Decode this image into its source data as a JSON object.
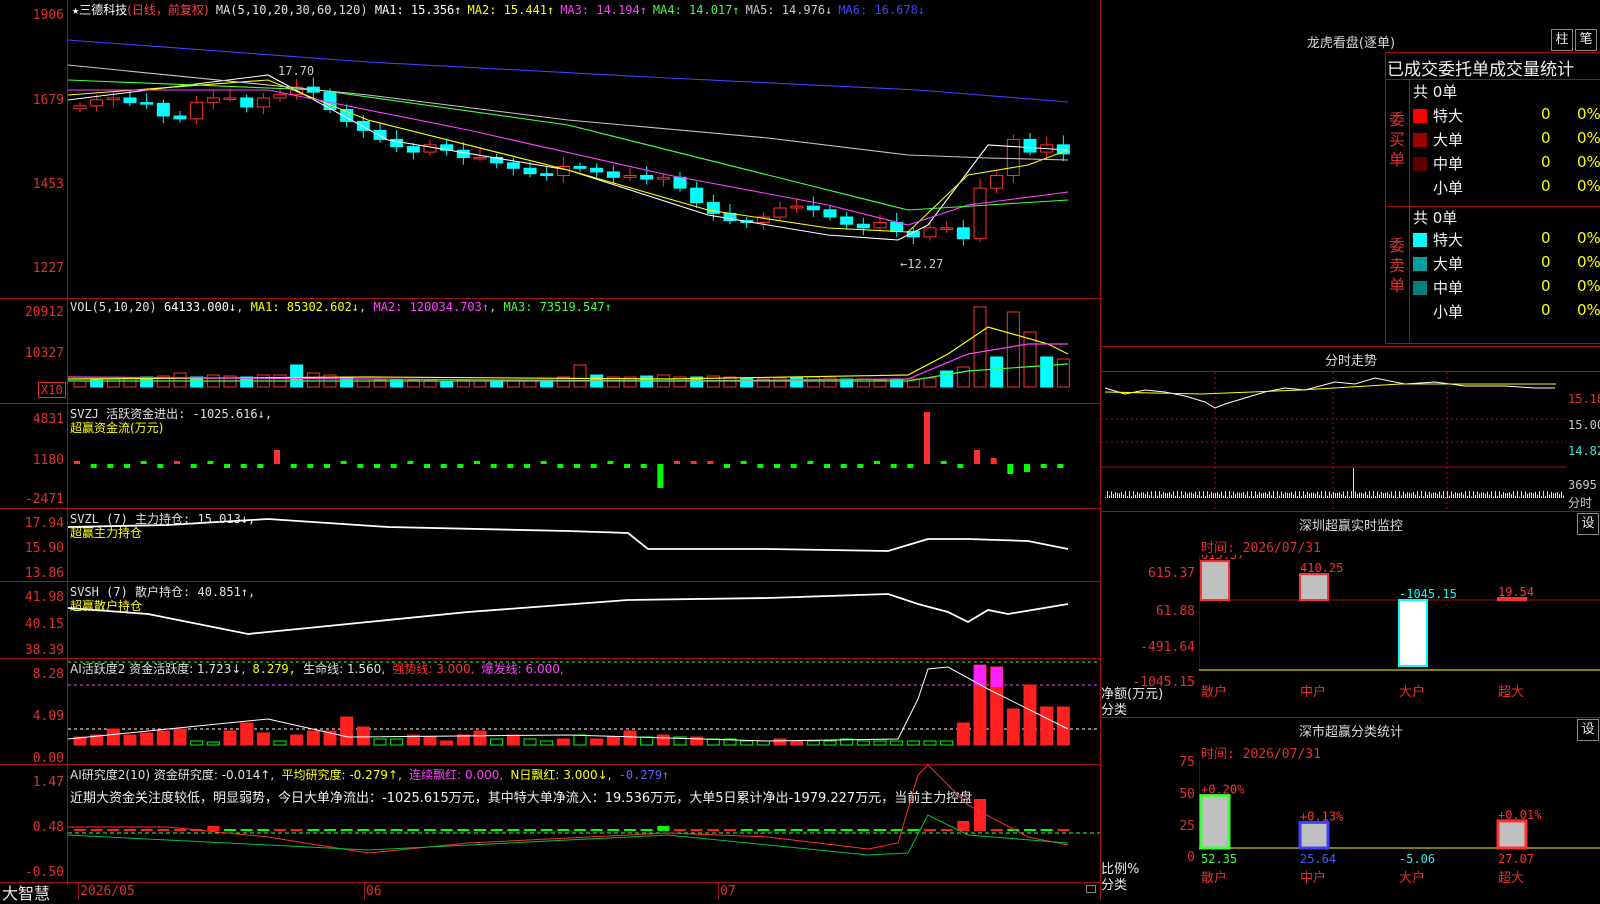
{
  "app": {
    "name": "大智慧"
  },
  "kline": {
    "title": "三德科技",
    "period": "(日线，前复权)",
    "ma_label": "MA(5,10,20,30,60,120)",
    "ma": [
      {
        "label": "MA1: 15.356↑",
        "color": "#ffffff"
      },
      {
        "label": "MA2: 15.441↑",
        "color": "#ffff00"
      },
      {
        "label": "MA3: 14.194↑",
        "color": "#ff40ff"
      },
      {
        "label": "MA4: 14.017↑",
        "color": "#40ff40"
      },
      {
        "label": "MA5: 14.976↓",
        "color": "#c8c8c8"
      },
      {
        "label": "MA6: 16.678↓",
        "color": "#4040ff"
      }
    ],
    "y_ticks": [
      "1906",
      "1679",
      "1453",
      "1227"
    ],
    "high_label": "17.70",
    "low_label": "←12.27"
  },
  "vol": {
    "header": "VOL(5,10,20)",
    "value": "64133.000↓",
    "ma1": "MA1: 85302.602↓",
    "ma2": "MA2: 120034.703↑",
    "ma3": "MA3: 73519.547↑",
    "y_ticks": [
      "20912",
      "10327"
    ],
    "unit": "X10"
  },
  "svzj": {
    "header": "SVZJ  活跃资金进出: -1025.616↓,",
    "sub": "超赢资金流(万元)",
    "y_ticks": [
      "4831",
      "1180",
      "-2471"
    ]
  },
  "svzl": {
    "header": "SVZL (7) 主力持仓: 15.013↓,",
    "sub": "超赢主力持仓",
    "y_ticks": [
      "17.94",
      "15.90",
      "13.86"
    ]
  },
  "svsh": {
    "header": "SVSH (7) 散户持仓: 40.851↑,",
    "sub": "超赢散户持仓",
    "y_ticks": [
      "41.98",
      "40.15",
      "38.39"
    ]
  },
  "ai1": {
    "header_a": "AI活跃度2 资金活跃度: 1.723↓,",
    "header_b": "8.279,",
    "header_c": "生命线: 1.560,",
    "header_d": "强势线: 3.000,",
    "header_e": "爆发线: 6.000,",
    "y_ticks": [
      "8.28",
      "4.09",
      "0.00"
    ]
  },
  "ai2": {
    "header_a": "AI研究度2(10) 资金研究度: -0.014↑,",
    "header_b": "平均研究度: -0.279↑,",
    "header_c": "连续飘红: 0.000,",
    "header_d": "N日飘红: 3.000↓,",
    "header_e": "-0.279↑",
    "comment": "近期大资金关注度较低，明显弱势，今日大单净流出：-1025.615万元，其中特大单净流入：19.536万元，大单5日累计净出-1979.227万元，当前主力控盘",
    "y_ticks": [
      "1.47",
      "0.48",
      "-0.50"
    ]
  },
  "x_axis": {
    "labels": [
      "2026/05",
      "06",
      "07"
    ]
  },
  "longhu": {
    "title": "龙虎看盘(逐单)",
    "btn_zhu": "柱",
    "btn_bi": "笔",
    "tabs": "已成交委托单成交量统计",
    "buy_label": "委买单",
    "sell_label": "委卖单",
    "buy_total": "共 0单",
    "sell_total": "共 0单",
    "buy_rows": [
      {
        "name": "特大",
        "count": "0",
        "pct": "0%",
        "color": "#ff0000"
      },
      {
        "name": "大单",
        "count": "0",
        "pct": "0%",
        "color": "#a00000"
      },
      {
        "name": "中单",
        "count": "0",
        "pct": "0%",
        "color": "#600000"
      },
      {
        "name": "小单",
        "count": "0",
        "pct": "0%",
        "color": ""
      }
    ],
    "sell_rows": [
      {
        "name": "特大",
        "count": "0",
        "pct": "0%",
        "color": "#00ffff"
      },
      {
        "name": "大单",
        "count": "0",
        "pct": "0%",
        "color": "#00a0a0"
      },
      {
        "name": "中单",
        "count": "0",
        "pct": "0%",
        "color": "#008080"
      },
      {
        "name": "小单",
        "count": "0",
        "pct": "0%",
        "color": ""
      }
    ]
  },
  "fenshi": {
    "title": "分时走势",
    "y_ticks": [
      "15.18",
      "15.00",
      "14.82"
    ],
    "vol_label": "3695",
    "vol_unit": "分时"
  },
  "sz_monitor": {
    "title": "深圳超赢实时监控",
    "btn": "设",
    "time": "时间: 2026/07/31",
    "y_ticks": [
      "615.37",
      "61.88",
      "-491.64",
      "-1045.15"
    ],
    "y_unit": "净额(万元)",
    "x_unit": "分类",
    "cats": [
      "散户",
      "中户",
      "大户",
      "超大"
    ],
    "values": [
      615.37,
      410.25,
      -1045.15,
      19.54
    ],
    "value_labels": [
      "615.37",
      "410.25",
      "-1045.15",
      "19.54"
    ]
  },
  "sz_class": {
    "title": "深市超赢分类统计",
    "btn": "设",
    "time": "时间: 2026/07/31",
    "y_ticks": [
      "75",
      "50",
      "25",
      "0"
    ],
    "y_unit": "比例%",
    "x_unit": "分类",
    "cats": [
      "散户",
      "中户",
      "大户",
      "超大"
    ],
    "top_labels": [
      "+0.20%",
      "+0.13%",
      "",
      "+0.01%"
    ],
    "bottom_labels": [
      "52.35",
      "25.64",
      "-5.06",
      "27.07"
    ],
    "values": [
      52.35,
      25.64,
      0,
      27.07
    ]
  }
}
